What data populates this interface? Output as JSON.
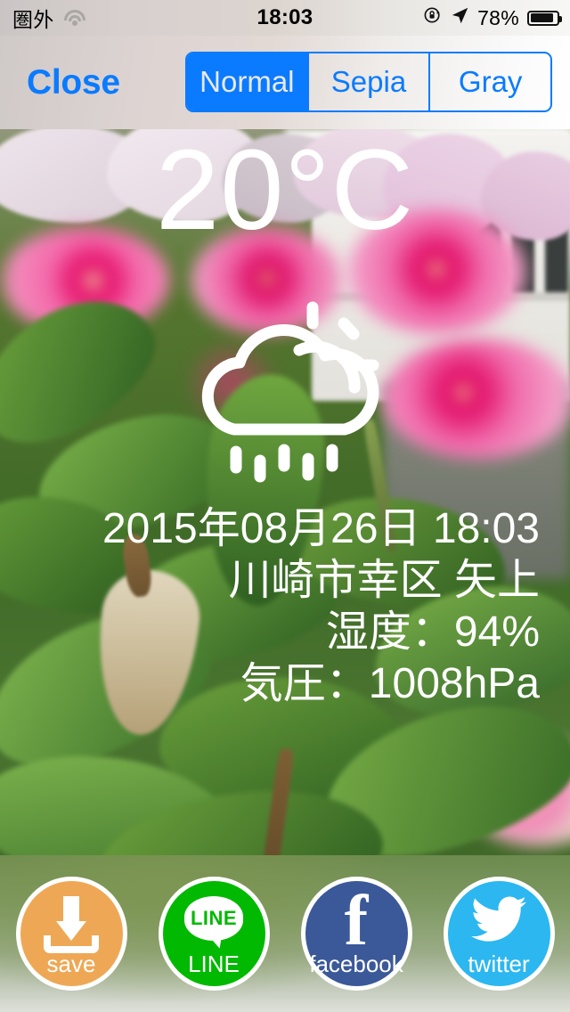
{
  "status_bar": {
    "carrier": "圏外",
    "wifi_icon": "wifi-icon",
    "time": "18:03",
    "rotation_lock_icon": "rotation-lock-icon",
    "location_icon": "location-arrow-icon",
    "battery_percent": "78%",
    "battery_level": 78,
    "battery_icon": "battery-icon"
  },
  "nav_bar": {
    "close_label": "Close",
    "filter_segments": [
      {
        "label": "Normal",
        "selected": true
      },
      {
        "label": "Sepia",
        "selected": false
      },
      {
        "label": "Gray",
        "selected": false
      }
    ],
    "accent_color": "#0a7bff"
  },
  "weather": {
    "temperature": "20°C",
    "condition_icon": "sun-behind-rain-cloud-icon",
    "datetime": "2015年08月26日 18:03",
    "location": "川崎市幸区 矢上",
    "humidity": "湿度：94%",
    "pressure": "気圧：1008hPa",
    "text_color": "#ffffff"
  },
  "toolbar": {
    "buttons": [
      {
        "name": "save",
        "label": "save",
        "icon": "download-tray-icon",
        "color": "#eea855"
      },
      {
        "name": "line",
        "label": "LINE",
        "icon": "line-bubble-icon",
        "color": "#00b900",
        "glyph": "LINE"
      },
      {
        "name": "facebook",
        "label": "facebook",
        "icon": "facebook-f-icon",
        "color": "#3b5998",
        "glyph": "f"
      },
      {
        "name": "twitter",
        "label": "twitter",
        "icon": "twitter-bird-icon",
        "color": "#2cb7f0"
      }
    ]
  }
}
